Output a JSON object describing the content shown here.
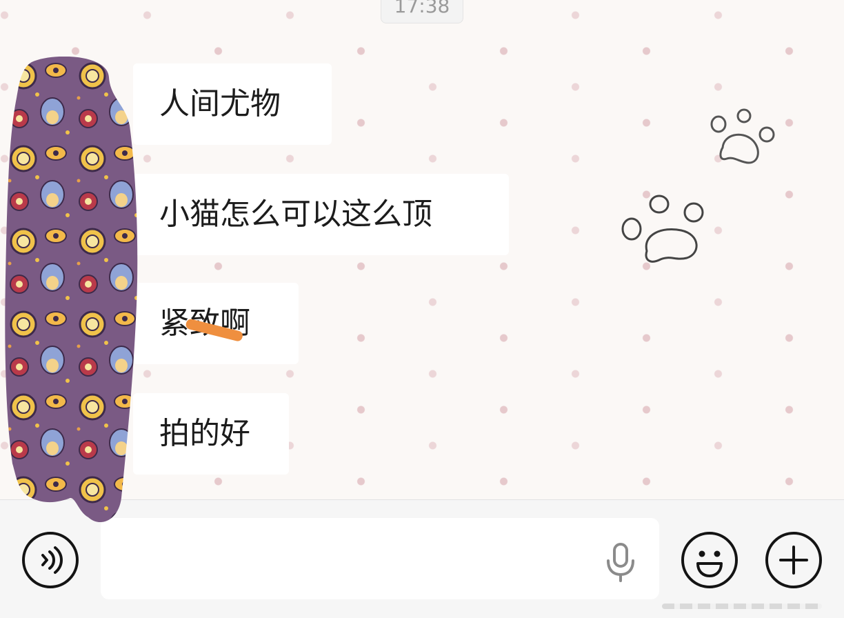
{
  "status": {
    "time": "17:38"
  },
  "chat": {
    "messages": [
      {
        "sender": "contact",
        "text": "人间尤物"
      },
      {
        "sender": "contact",
        "text": "小猫怎么可以这么顶"
      },
      {
        "sender": "contact",
        "text": "紧致啊"
      },
      {
        "sender": "contact",
        "text": "拍的好"
      }
    ]
  },
  "input_bar": {
    "text_value": "",
    "icons": {
      "voice": "voice-wave-icon",
      "mic": "microphone-icon",
      "emoji": "smiley-face-icon",
      "more": "plus-icon"
    }
  },
  "colors": {
    "wallpaper_bg": "#fbf8f6",
    "wallpaper_dot": "#e6c9cc",
    "bubble_bg": "#ffffff",
    "redaction_mark": "#ef8f3f",
    "avatar_cover": "#7a5a84"
  }
}
